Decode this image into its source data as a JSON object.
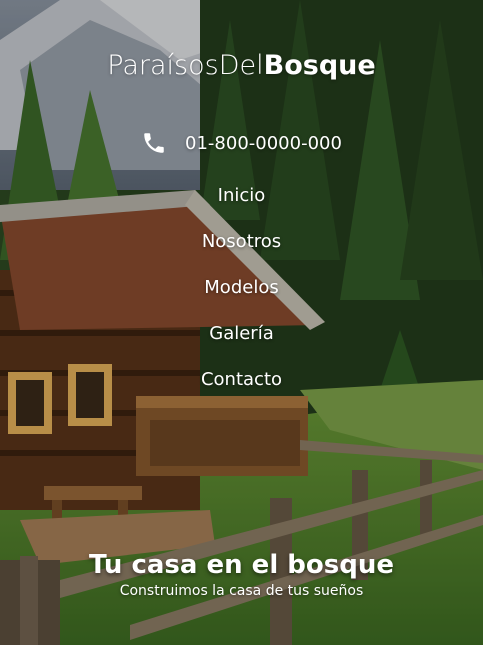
{
  "brand": {
    "name_light": "ParaísosDel",
    "name_bold": "Bosque"
  },
  "contact": {
    "phone_icon": "phone-icon",
    "phone": "01-800-0000-000"
  },
  "nav": {
    "items": [
      {
        "label": "Inicio"
      },
      {
        "label": "Nosotros"
      },
      {
        "label": "Modelos"
      },
      {
        "label": "Galería"
      },
      {
        "label": "Contacto"
      }
    ]
  },
  "hero": {
    "headline": "Tu casa en el bosque",
    "subheadline": "Construimos la casa de tus sueños"
  },
  "colors": {
    "text": "#ffffff",
    "overlay": "#000000",
    "forest": "#2c4a22",
    "wood": "#6b3f1f",
    "grass": "#4f8a2a"
  }
}
